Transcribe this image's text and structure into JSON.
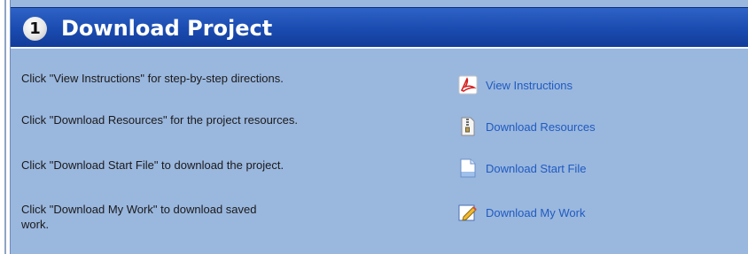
{
  "header": {
    "step_number": "1",
    "title": "Download Project"
  },
  "rows": [
    {
      "description": "Click \"View Instructions\" for step-by-step directions.",
      "link_label": "View Instructions",
      "icon": "pdf-icon"
    },
    {
      "description": "Click \"Download Resources\" for the project resources.",
      "link_label": "Download Resources",
      "icon": "zip-archive-icon"
    },
    {
      "description": "Click \"Download Start File\" to download the project.",
      "link_label": "Download Start File",
      "icon": "document-icon"
    },
    {
      "description": "Click \"Download My Work\" to download saved work.",
      "link_label": "Download My Work",
      "icon": "edit-pencil-icon"
    }
  ],
  "colors": {
    "header_blue": "#1a4bb0",
    "panel_background": "#9ab7de",
    "link_blue": "#1f5bc0"
  }
}
